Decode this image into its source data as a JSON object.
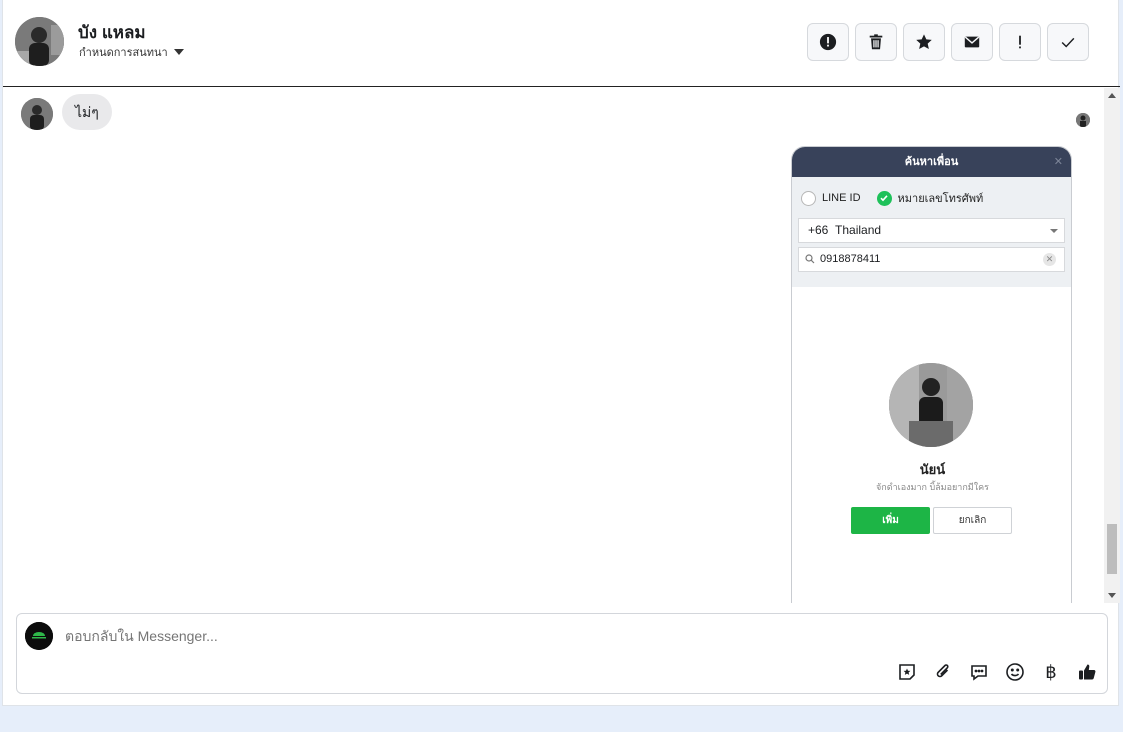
{
  "header": {
    "name": "บัง แหลม",
    "subtitle": "กำหนดการสนทนา",
    "tools": [
      {
        "icon": "exclamation-circle-icon"
      },
      {
        "icon": "trash-icon"
      },
      {
        "icon": "star-icon"
      },
      {
        "icon": "envelope-icon"
      },
      {
        "icon": "exclamation-icon"
      },
      {
        "icon": "check-icon"
      }
    ]
  },
  "conversation": {
    "incoming_message": "ไม่ๆ"
  },
  "line_card": {
    "title": "ค้นหาเพื่อน",
    "option_line_id": "LINE ID",
    "option_phone": "หมายเลขโทรศัพท์",
    "country_code": "+66",
    "country_name": "Thailand",
    "phone_value": "0918878411",
    "profile_name": "นัยน์",
    "profile_status": "จักดำเองมาก บิ้ล้มอยากมีใคร",
    "add_label": "เพิ่ม",
    "cancel_label": "ยกเลิก",
    "accent_color": "#1db546",
    "title_bar_color": "#38425a"
  },
  "composer": {
    "placeholder": "ตอบกลับใน Messenger...",
    "icons": [
      "sticker-icon",
      "attachment-icon",
      "quick-reply-icon",
      "emoji-icon",
      "baht-payment-icon",
      "thumbs-up-icon"
    ]
  }
}
